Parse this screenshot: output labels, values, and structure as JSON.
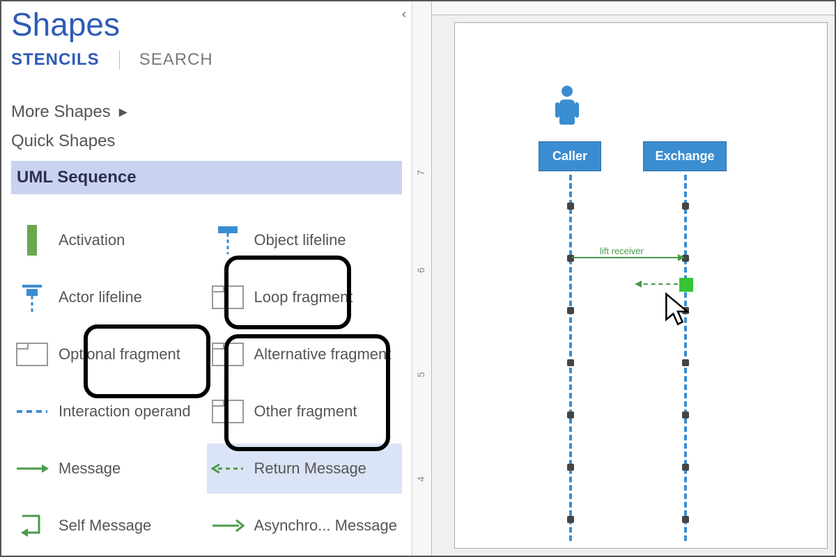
{
  "panel": {
    "title": "Shapes",
    "tabs": {
      "stencils": "STENCILS",
      "search": "SEARCH"
    },
    "more_shapes": "More Shapes",
    "quick_shapes": "Quick Shapes",
    "stencil_header": "UML Sequence"
  },
  "shapes": {
    "activation": "Activation",
    "object_lifeline": "Object lifeline",
    "actor_lifeline": "Actor lifeline",
    "loop_fragment": "Loop fragment",
    "optional_fragment": "Optional fragment",
    "alternative_fragment": "Alternative fragment",
    "interaction_operand": "Interaction operand",
    "other_fragment": "Other fragment",
    "message": "Message",
    "return_message": "Return Message",
    "self_message": "Self Message",
    "async_message": "Asynchro... Message"
  },
  "diagram": {
    "caller": "Caller",
    "exchange": "Exchange",
    "msg1_label": "lift receiver"
  },
  "ruler": {
    "t7": "7",
    "t6": "6",
    "t5": "5",
    "t4": "4"
  }
}
